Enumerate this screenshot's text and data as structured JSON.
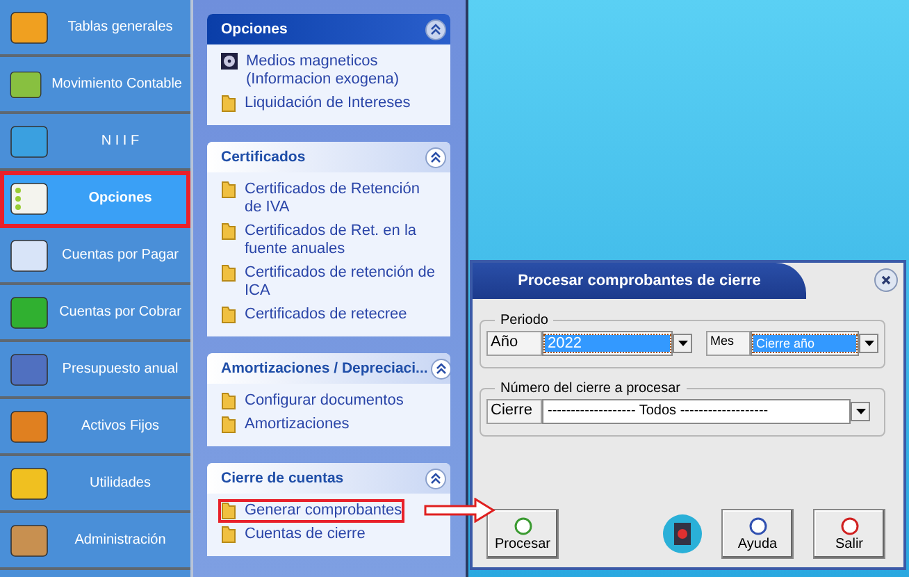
{
  "sidebar": {
    "items": [
      {
        "label": "Tablas generales",
        "selected": false
      },
      {
        "label": "Movimiento Contable",
        "selected": false
      },
      {
        "label": "N I I F",
        "selected": false
      },
      {
        "label": "Opciones",
        "selected": true
      },
      {
        "label": "Cuentas por Pagar",
        "selected": false
      },
      {
        "label": "Cuentas por Cobrar",
        "selected": false
      },
      {
        "label": "Presupuesto anual",
        "selected": false
      },
      {
        "label": "Activos Fijos",
        "selected": false
      },
      {
        "label": "Utilidades",
        "selected": false
      },
      {
        "label": "Administración",
        "selected": false
      }
    ]
  },
  "panels": [
    {
      "title": "Opciones",
      "kind": "special",
      "items": [
        {
          "label": "Medios magneticos (Informacion exogena)",
          "highlighted": false
        },
        {
          "label": "Liquidación de Intereses",
          "highlighted": false
        }
      ]
    },
    {
      "title": "Certificados",
      "kind": "normal",
      "items": [
        {
          "label": "Certificados de Retención de IVA",
          "highlighted": false
        },
        {
          "label": "Certificados de Ret. en la fuente anuales",
          "highlighted": false
        },
        {
          "label": "Certificados de retención de ICA",
          "highlighted": false
        },
        {
          "label": "Certificados de retecree",
          "highlighted": false
        }
      ]
    },
    {
      "title": "Amortizaciones / Depreciaci...",
      "kind": "normal",
      "items": [
        {
          "label": "Configurar documentos",
          "highlighted": false
        },
        {
          "label": "Amortizaciones",
          "highlighted": false
        }
      ]
    },
    {
      "title": "Cierre de cuentas",
      "kind": "normal",
      "items": [
        {
          "label": "Generar comprobantes",
          "highlighted": true
        },
        {
          "label": "Cuentas de cierre",
          "highlighted": false
        }
      ]
    }
  ],
  "dialog": {
    "title": "Procesar comprobantes de cierre",
    "periodo": {
      "legend": "Periodo",
      "year_label": "Año",
      "year_value": "2022",
      "month_label": "Mes",
      "month_value": "Cierre año"
    },
    "cierre": {
      "legend": "Número del cierre a procesar",
      "label": "Cierre",
      "value": "------------------- Todos -------------------"
    },
    "buttons": [
      {
        "label": "Procesar"
      },
      {
        "label": "Ayuda"
      },
      {
        "label": "Salir"
      }
    ]
  }
}
